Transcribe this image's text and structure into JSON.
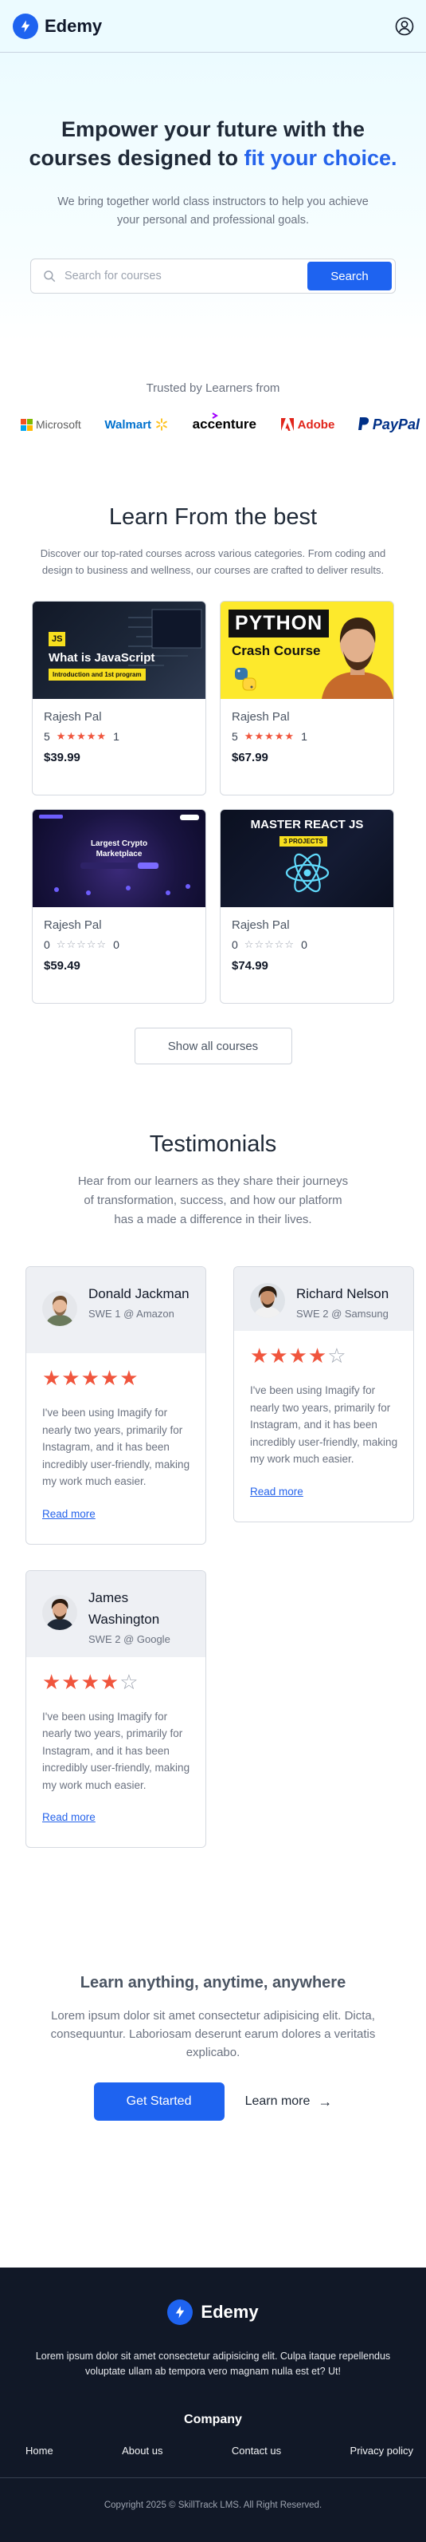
{
  "brand": {
    "name": "Edemy",
    "color": "#1e63f0"
  },
  "hero": {
    "title_prefix": "Empower your future with the courses designed to ",
    "title_accent": "fit your choice.",
    "subtitle": "We bring together world class instructors to help you achieve your personal and professional goals.",
    "search_placeholder": "Search for courses",
    "search_button": "Search"
  },
  "trusted": {
    "label": "Trusted by Learners from",
    "logos": [
      "Microsoft",
      "Walmart",
      "accenture",
      "Adobe",
      "PayPal"
    ]
  },
  "courses": {
    "title": "Learn From the best",
    "description": "Discover our top-rated courses across various categories. From coding and design to business and wellness, our courses are crafted to deliver results.",
    "items": [
      {
        "thumb_title": "What is JavaScript",
        "thumb_tag": "Introduction and 1st program",
        "thumb_badge": "JS",
        "instructor": "Rajesh Pal",
        "rating": "5",
        "rating_count": "1",
        "stars": "★★★★★",
        "price": "$39.99"
      },
      {
        "thumb_title": "PYTHON",
        "thumb_tag": "Crash Course",
        "instructor": "Rajesh Pal",
        "rating": "5",
        "rating_count": "1",
        "stars": "★★★★★",
        "price": "$67.99"
      },
      {
        "thumb_title": "Largest Crypto Marketplace",
        "instructor": "Rajesh Pal",
        "rating": "0",
        "rating_count": "0",
        "stars": "☆☆☆☆☆",
        "price": "$59.49"
      },
      {
        "thumb_title": "MASTER REACT JS",
        "thumb_tag": "3 PROJECTS",
        "instructor": "Rajesh Pal",
        "rating": "0",
        "rating_count": "0",
        "stars": "☆☆☆☆☆",
        "price": "$74.99"
      }
    ],
    "show_all": "Show all courses"
  },
  "testimonials": {
    "title": "Testimonials",
    "description": "Hear from our learners as they share their journeys of transformation, success, and how our platform has a made a difference in their lives.",
    "items": [
      {
        "name": "Donald Jackman",
        "role": "SWE 1 @ Amazon",
        "rating": 5,
        "quote": "I've been using Imagify for nearly two years, primarily for Instagram, and it has been incredibly user-friendly, making my work much easier.",
        "link": "Read more"
      },
      {
        "name": "Richard Nelson",
        "role": "SWE 2 @ Samsung",
        "rating": 4,
        "quote": "I've been using Imagify for nearly two years, primarily for Instagram, and it has been incredibly user-friendly, making my work much easier.",
        "link": "Read more"
      },
      {
        "name": "James Washington",
        "role": "SWE 2 @ Google",
        "rating": 4,
        "quote": "I've been using Imagify for nearly two years, primarily for Instagram, and it has been incredibly user-friendly, making my work much easier.",
        "link": "Read more"
      }
    ]
  },
  "cta": {
    "title": "Learn anything, anytime, anywhere",
    "text": "Lorem ipsum dolor sit amet consectetur adipisicing elit. Dicta, consequuntur. Laboriosam deserunt earum dolores a veritatis explicabo.",
    "primary": "Get Started",
    "secondary": "Learn more",
    "secondary_arrow": "→"
  },
  "footer": {
    "description": "Lorem ipsum dolor sit amet consectetur adipisicing elit. Culpa itaque repellendus voluptate ullam ab tempora vero magnam nulla est et? Ut!",
    "company_heading": "Company",
    "links": [
      "Home",
      "About us",
      "Contact us",
      "Privacy policy"
    ],
    "copyright": "Copyright 2025 © SkillTrack LMS. All Right Reserved."
  }
}
